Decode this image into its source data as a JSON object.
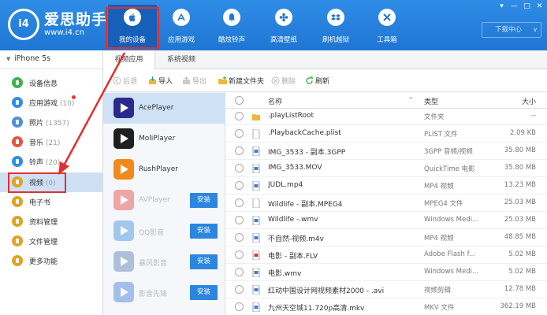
{
  "brand": {
    "logo_text": "i4",
    "name": "爱思助手",
    "url": "www.i4.cn"
  },
  "nav": [
    {
      "label": "我的设备",
      "icon": "apple-icon",
      "active": true
    },
    {
      "label": "应用游戏",
      "icon": "appstore-icon"
    },
    {
      "label": "酷炫铃声",
      "icon": "bell-icon"
    },
    {
      "label": "高清壁纸",
      "icon": "flower-icon"
    },
    {
      "label": "刷机越狱",
      "icon": "dropbox-icon"
    },
    {
      "label": "工具箱",
      "icon": "tools-icon"
    }
  ],
  "window_controls": [
    "▾",
    "—",
    "□",
    "✕"
  ],
  "download_center": "下载中心",
  "device": {
    "caret": "▼",
    "name": "iPhone 5s"
  },
  "sidebar": [
    {
      "label": "设备信息",
      "count": "",
      "icon": "info-icon",
      "color": "#3bb54a"
    },
    {
      "label": "应用游戏",
      "count": "(10)",
      "icon": "appstore-icon",
      "color": "#2f8de6",
      "badge": true
    },
    {
      "label": "照片",
      "count": "(1357)",
      "icon": "photo-icon",
      "color": "#4a90d9"
    },
    {
      "label": "音乐",
      "count": "(21)",
      "icon": "music-icon",
      "color": "#e8543c"
    },
    {
      "label": "铃声",
      "count": "(20)",
      "icon": "bell-icon",
      "color": "#2f8de6"
    },
    {
      "label": "视频",
      "count": "(0)",
      "icon": "video-icon",
      "color": "#e0a323",
      "active": true
    },
    {
      "label": "电子书",
      "count": "",
      "icon": "book-icon",
      "color": "#e0a323"
    },
    {
      "label": "资料管理",
      "count": "",
      "icon": "contacts-icon",
      "color": "#e0a323"
    },
    {
      "label": "文件管理",
      "count": "",
      "icon": "folder-icon",
      "color": "#e0a323"
    },
    {
      "label": "更多功能",
      "count": "",
      "icon": "grid-icon",
      "color": "#e0a323"
    }
  ],
  "tabs": [
    {
      "label": "视频应用",
      "active": true
    },
    {
      "label": "系统视频"
    }
  ],
  "toolbar": {
    "back": "后退",
    "import": "导入",
    "export": "导出",
    "new_folder": "新建文件夹",
    "delete": "删除",
    "refresh": "刷新"
  },
  "apps": [
    {
      "name": "AcePlayer",
      "color": "#2a2a8c",
      "active": true
    },
    {
      "name": "MoliPlayer",
      "color": "#1f1f1f"
    },
    {
      "name": "RushPlayer",
      "color": "#f08a1c"
    },
    {
      "name": "AVPlayer",
      "color": "#e2453a",
      "dim": true,
      "install": "安装"
    },
    {
      "name": "QQ影音",
      "color": "#3f8fe0",
      "dim": true,
      "install": "安装"
    },
    {
      "name": "暴风影音",
      "color": "#5a7fb0",
      "dim": true,
      "install": "安装"
    },
    {
      "name": "影音先锋",
      "color": "#3f7fd8",
      "dim": true,
      "install": "安装"
    }
  ],
  "file_table": {
    "headers": {
      "name": "名称",
      "type": "类型",
      "size": "大小",
      "sort_arrow": "^"
    },
    "rows": [
      {
        "name": ".playListRoot",
        "type": "文件夹",
        "size": "--",
        "icon": "folder-icon"
      },
      {
        "name": ".PlaybackCache.plist",
        "type": "PLIST 文件",
        "size": "2.09 KB",
        "icon": "doc-icon"
      },
      {
        "name": "IMG_3533 - 副本.3GPP",
        "type": "3GPP 音频/视频",
        "size": "35.80 MB",
        "icon": "video-file-icon"
      },
      {
        "name": "IMG_3533.MOV",
        "type": "QuickTime 电影",
        "size": "35.80 MB",
        "icon": "video-file-icon"
      },
      {
        "name": "JUDL.mp4",
        "type": "MP4 视频",
        "size": "13.23 MB",
        "icon": "video-file-icon"
      },
      {
        "name": "Wildlife - 副本.MPEG4",
        "type": "MPEG4 文件",
        "size": "25.03 MB",
        "icon": "doc-icon"
      },
      {
        "name": "Wildlife -.wmv",
        "type": "Windows Medi...",
        "size": "25.03 MB",
        "icon": "video-file-icon"
      },
      {
        "name": "不自然-视频.m4v",
        "type": "MP4 视频",
        "size": "48.85 MB",
        "icon": "video-file-icon"
      },
      {
        "name": "电影 - 副本.FLV",
        "type": "Adobe Flash f...",
        "size": "5.02 MB",
        "icon": "flash-file-icon"
      },
      {
        "name": "电影.wmv",
        "type": "Windows Medi...",
        "size": "5.02 MB",
        "icon": "video-file-icon"
      },
      {
        "name": "红动中国设计网视频素材2000 - .avi",
        "type": "视频剪辑",
        "size": "12.78 MB",
        "icon": "video-file-icon"
      },
      {
        "name": "九州天空城11.720p高清.mkv",
        "type": "MKV 文件",
        "size": "362.19 MB",
        "icon": "video-file-icon"
      }
    ]
  },
  "colors": {
    "header_blue": "#2f8de6",
    "annotation_red": "#e0302f",
    "install_blue": "#2c86e0"
  }
}
